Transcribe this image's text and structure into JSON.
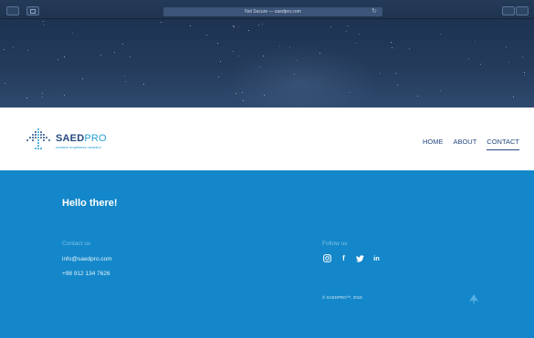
{
  "browser": {
    "address": "Not Secure — saedpro.com",
    "reload_icon": "reload-icon",
    "back_icon": "back-icon",
    "sidebar_icon": "sidebar-icon",
    "share_icon": "share-icon",
    "tabs_icon": "tabs-icon"
  },
  "header": {
    "logo": {
      "word_main": "SAED",
      "word_accent": "PRO",
      "tagline": "creative emptiness mediator"
    },
    "nav": [
      {
        "label": "HOME",
        "active": false
      },
      {
        "label": "ABOUT",
        "active": false
      },
      {
        "label": "CONTACT",
        "active": true
      }
    ]
  },
  "footer": {
    "greeting": "Hello there!",
    "contact": {
      "heading": "Contact us",
      "email": "info@saedpro.com",
      "phone": "+98 912 134 7626"
    },
    "follow": {
      "heading": "Follow us",
      "socials": [
        "instagram-icon",
        "facebook-icon",
        "twitter-icon",
        "linkedin-icon"
      ]
    },
    "copyright": "© SAEDPRO™, 2018",
    "up_icon": "scroll-top-icon"
  },
  "colors": {
    "chrome": "#243a57",
    "hero": "#243b5c",
    "brand_dark": "#264a82",
    "brand_accent": "#2a9fd6",
    "footer_bg": "#1387c9"
  }
}
